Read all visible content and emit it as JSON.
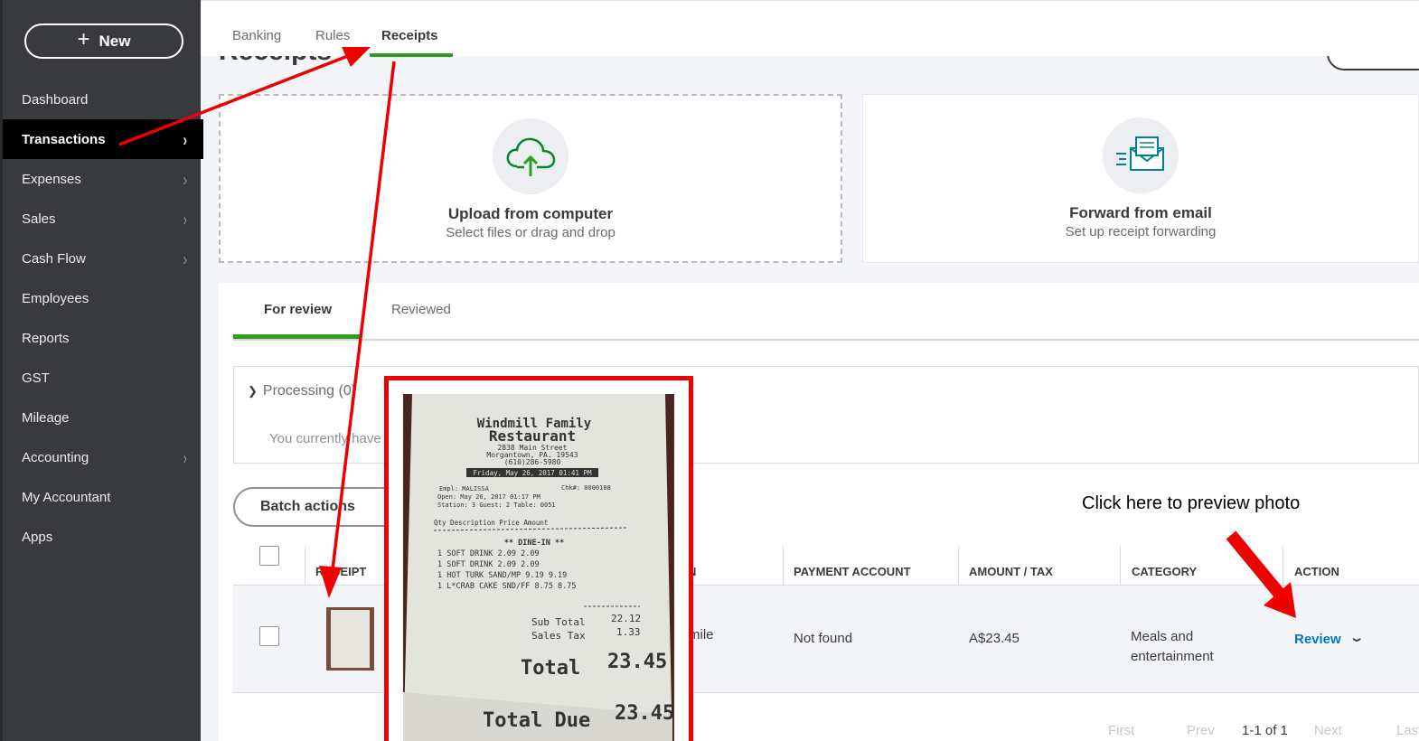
{
  "sidebar": {
    "new_label": "New",
    "items": [
      {
        "label": "Dashboard"
      },
      {
        "label": "Transactions"
      },
      {
        "label": "Expenses"
      },
      {
        "label": "Sales"
      },
      {
        "label": "Cash Flow"
      },
      {
        "label": "Employees"
      },
      {
        "label": "Reports"
      },
      {
        "label": "GST"
      },
      {
        "label": "Mileage"
      },
      {
        "label": "Accounting"
      },
      {
        "label": "My Accountant"
      },
      {
        "label": "Apps"
      }
    ]
  },
  "tabs": {
    "banking": "Banking",
    "rules": "Rules",
    "receipts": "Receipts"
  },
  "page_title": "Receipts",
  "upload": {
    "title": "Upload from computer",
    "subtitle": "Select files or drag and drop"
  },
  "email": {
    "title": "Forward from email",
    "subtitle": "Set up receipt forwarding"
  },
  "review_tabs": {
    "for_review": "For review",
    "reviewed": "Reviewed"
  },
  "processing": {
    "header": "Processing (0)",
    "empty_text": "You currently have"
  },
  "batch_actions": "Batch actions",
  "table": {
    "headers": {
      "receipt": "RECEIPT",
      "description_fragment": "N",
      "payment_account": "PAYMENT ACCOUNT",
      "amount_tax": "AMOUNT / TAX",
      "category": "CATEGORY",
      "action": "ACTION"
    },
    "row": {
      "description_fragment": "mile",
      "payment_account": "Not found",
      "amount": "A$23.45",
      "category_line1": "Meals and",
      "category_line2": "entertainment",
      "action": "Review"
    }
  },
  "pagination": {
    "first": "First",
    "prev": "Prev",
    "count": "1-1 of 1",
    "next": "Next",
    "last": "Last"
  },
  "annotation": "Click here to preview photo",
  "receipt_photo": {
    "line1": "Windmill Family",
    "line2": "Restaurant",
    "address1": "2838 Main Street",
    "address2": "Morgantown, PA. 19543",
    "phone": "(610)286-5980",
    "date": "Friday, May 26, 2017 01:41 PM",
    "empl": "Empl: MALISSA",
    "chk": "Chk#: 0000108",
    "open": "Open: May 26, 2017 01:17 PM",
    "station": "Station: 3     Guest: 2     Table: 0051",
    "cols": "Qty Description      Price   Amount",
    "dine": "** DINE-IN **",
    "item1": "1 SOFT DRINK          2.09     2.09",
    "item2": "1 SOFT DRINK          2.09     2.09",
    "item3": "1 HOT TURK SAND/MP     9.19     9.19",
    "item4": "1 L*CRAB CAKE SND/FF   8.75     8.75",
    "subtotal_label": "Sub Total",
    "subtotal": "22.12",
    "tax_label": "Sales Tax",
    "tax": "1.33",
    "total_label": "Total",
    "total": "23.45",
    "due_label": "Total Due",
    "due": "23.45"
  },
  "colors": {
    "sidebar_bg": "#393a3d",
    "active_nav_bg": "#000000",
    "accent_green": "#2ca01c",
    "link_blue": "#0077c5",
    "annotation_red": "#e00000"
  }
}
